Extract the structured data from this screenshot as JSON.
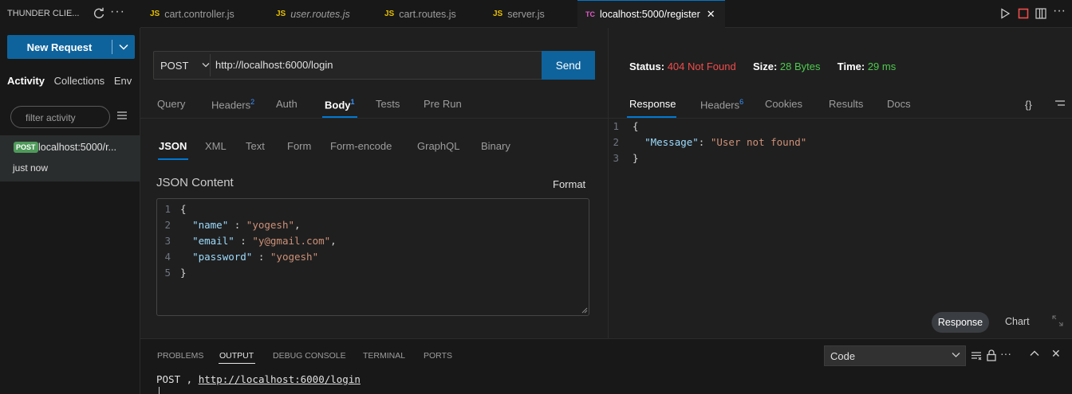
{
  "sidebar": {
    "title": "THUNDER CLIE...",
    "more": "···",
    "new_request": "New Request",
    "tabs": [
      "Activity",
      "Collections",
      "Env"
    ],
    "filter_placeholder": "filter activity",
    "activity": {
      "method": "POST",
      "url": "localhost:5000/r...",
      "time": "just now"
    }
  },
  "editor_tabs": [
    {
      "icon": "JS",
      "label": "cart.controller.js"
    },
    {
      "icon": "JS",
      "label": "user.routes.js"
    },
    {
      "icon": "JS",
      "label": "cart.routes.js"
    },
    {
      "icon": "JS",
      "label": "server.js"
    },
    {
      "icon": "TC",
      "label": "localhost:5000/register",
      "close": "✕"
    }
  ],
  "titlebar": {
    "more": "···"
  },
  "request": {
    "method": "POST",
    "url": "http://localhost:6000/login",
    "send": "Send",
    "tabs": [
      "Query",
      "Headers",
      "Auth",
      "Body",
      "Tests",
      "Pre Run"
    ],
    "headers_count": "2",
    "body_count": "1",
    "body_types": [
      "JSON",
      "XML",
      "Text",
      "Form",
      "Form-encode",
      "GraphQL",
      "Binary"
    ],
    "content_title": "JSON Content",
    "format": "Format",
    "line_numbers": [
      "1",
      "2",
      "3",
      "4",
      "5"
    ],
    "json": {
      "open": "{",
      "k1": "\"name\"",
      "v1": "\"yogesh\"",
      "k2": "\"email\"",
      "v2": "\"y@gmail.com\"",
      "k3": "\"password\"",
      "v3": "\"yogesh\"",
      "close": "}"
    }
  },
  "response": {
    "status_label": "Status:",
    "status_value": "404 Not Found",
    "size_label": "Size:",
    "size_value": "28 Bytes",
    "time_label": "Time:",
    "time_value": "29 ms",
    "tabs": [
      "Response",
      "Headers",
      "Cookies",
      "Results",
      "Docs"
    ],
    "headers_count": "6",
    "braces": "{}",
    "line_numbers": [
      "1",
      "2",
      "3"
    ],
    "json": {
      "open": "{",
      "key": "\"Message\"",
      "value": "\"User not found\"",
      "close": "}"
    },
    "view_response": "Response",
    "view_chart": "Chart"
  },
  "panel": {
    "tabs": [
      "PROBLEMS",
      "OUTPUT",
      "DEBUG CONSOLE",
      "TERMINAL",
      "PORTS"
    ],
    "channel": "Code",
    "more": "···",
    "close": "✕",
    "output_prefix": "POST , ",
    "output_url": "http://localhost:6000/login"
  },
  "colors": {
    "accent": "#0078d4",
    "button": "#0e639c",
    "error": "#f14c4c",
    "success": "#4ec94e"
  }
}
